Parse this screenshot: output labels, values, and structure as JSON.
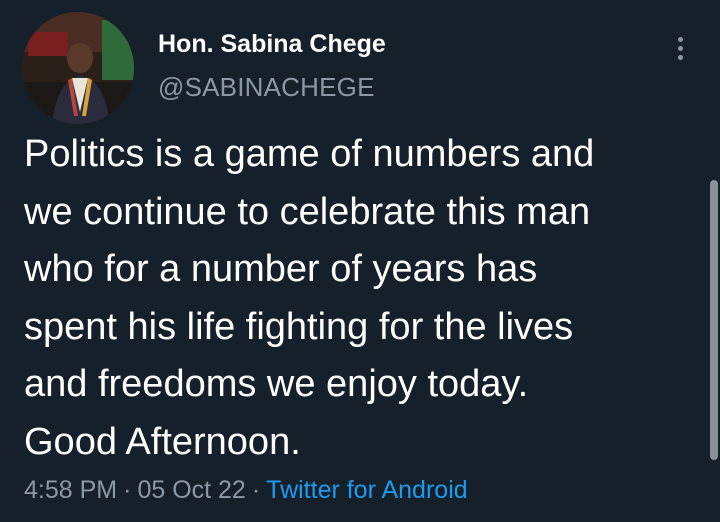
{
  "author": {
    "display_name": "Hon. Sabina Chege",
    "handle": "@SABINACHEGE"
  },
  "tweet": {
    "lines": [
      "Politics is a game of numbers and",
      "we continue to celebrate this man",
      "who for a number of years has",
      "spent his life fighting for the lives",
      "and freedoms we enjoy today.",
      "Good Afternoon."
    ],
    "time": "4:58 PM",
    "separator": "·",
    "date": "05 Oct 22",
    "source": "Twitter for Android"
  },
  "icons": {
    "more": "more-vertical-icon"
  },
  "colors": {
    "background": "#15202b",
    "text": "#ffffff",
    "secondary_text": "#8b98a5",
    "link": "#1d9bf0"
  }
}
